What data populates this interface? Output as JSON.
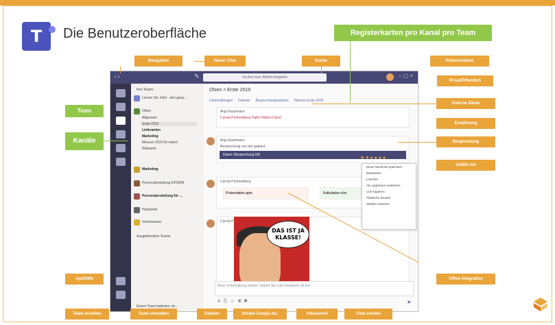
{
  "slide": {
    "title": "Die Benutzeroberfläche"
  },
  "teams_ui": {
    "search_placeholder": "Suchen bzw. Befehl eingeben",
    "sidebar_header": "Ihre Teams",
    "teams": [
      {
        "name": "Lernen Sie mich - den gesa..."
      },
      {
        "name": "Olsen"
      },
      {
        "name": "Allgemein"
      },
      {
        "name": "Erste 2019"
      },
      {
        "name": "Lieferanten"
      },
      {
        "name": "Marketing"
      },
      {
        "name": "Messen 2019 für extern"
      },
      {
        "name": "Webseite"
      },
      {
        "name": "Marketing"
      },
      {
        "name": "Personalerstellung INTERN"
      },
      {
        "name": "Personalerstellung für ..."
      },
      {
        "name": "Handwerk"
      },
      {
        "name": "Vereinsraum"
      },
      {
        "name": "Ausgeblendete Teams"
      }
    ],
    "channel_header": "Olsen  >  Erste 2019",
    "tabs": [
      "Unterhaltungen",
      "Dateien",
      "Besprechungsnotizen",
      "Planner Erste 2019"
    ],
    "messages": [
      {
        "author": "Anja Rauhmann",
        "text": "Carola Poehnelberg Hallo! Neben Dank!"
      },
      {
        "author": "Anja Rauhmann",
        "text": "Besprechung von der geplant"
      },
      {
        "author": "Carola Poehnelberg",
        "text": "Präsentation.pptx"
      },
      {
        "author": "Carola Poehnelberg",
        "text": ""
      }
    ],
    "meeting_card": "Daten: Besprechung 6/8",
    "attachments": [
      "Präsentation.pptx",
      "Kalkulation.xlsx"
    ],
    "comic_text": "DAS IST JA KLASSE!",
    "compose_placeholder": "Neue Unterhaltung starten. Geben Sie zum Erwähnen @ ein.",
    "context_menu": [
      "Diese Nachricht speichern",
      "Bearbeiten",
      "Löschen",
      "Als ungelesen markieren",
      "Link kopieren",
      "Plattische Reader",
      "Weitere Aktionen"
    ],
    "join_team": "Einem Team beitreten od..."
  },
  "callouts": {
    "navigation": "Navigation",
    "new_chat": "Neuer Chat",
    "search": "Suche",
    "tabs": "Registerkarten pro Kanal pro Team",
    "presence": "Präsenzstatus",
    "privacy": "Privat/Öffentlich",
    "team": "Team",
    "channels": "Kanäle",
    "guests": "Externe Gäste",
    "mention": "Erwähnung",
    "meeting": "Besprechung",
    "like": "Gefällt mir",
    "office": "Office Integration",
    "apps": "Aps/Hilfe",
    "create_team": "Team erstellen",
    "manage_team": "Team verwalten",
    "files": "Dateien",
    "sticker": "Sticker Emojis etc.",
    "video": "Videoanruf",
    "send": "Chat senden"
  },
  "colors": {
    "accent": "#e9a43a",
    "green": "#92c84a",
    "teams_purple": "#464775"
  }
}
